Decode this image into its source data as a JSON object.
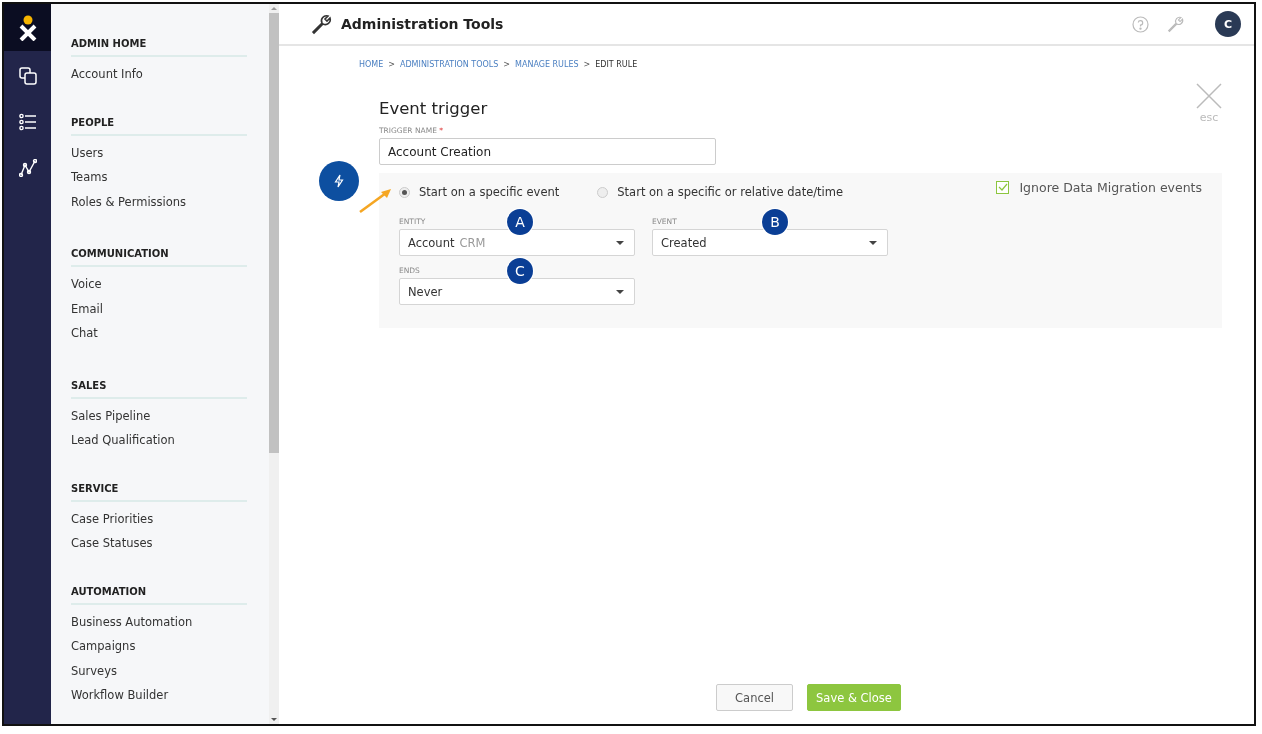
{
  "sidebar": {
    "sections": [
      {
        "title": "ADMIN HOME",
        "items": [
          "Account Info"
        ]
      },
      {
        "title": "PEOPLE",
        "items": [
          "Users",
          "Teams",
          "Roles & Permissions"
        ]
      },
      {
        "title": "COMMUNICATION",
        "items": [
          "Voice",
          "Email",
          "Chat"
        ]
      },
      {
        "title": "SALES",
        "items": [
          "Sales Pipeline",
          "Lead Qualification"
        ]
      },
      {
        "title": "SERVICE",
        "items": [
          "Case Priorities",
          "Case Statuses"
        ]
      },
      {
        "title": "AUTOMATION",
        "items": [
          "Business Automation",
          "Campaigns",
          "Surveys",
          "Workflow Builder"
        ]
      }
    ]
  },
  "header": {
    "title": "Administration Tools",
    "avatar": "C"
  },
  "breadcrumb": [
    {
      "label": "HOME",
      "current": false
    },
    {
      "label": "ADMINISTRATION TOOLS",
      "current": false
    },
    {
      "label": "MANAGE RULES",
      "current": false
    },
    {
      "label": "EDIT RULE",
      "current": true
    }
  ],
  "breadcrumb_separator": ">",
  "form": {
    "title": "Event trigger",
    "close_hint": "esc",
    "trigger_name": {
      "label": "TRIGGER NAME",
      "required_mark": "*",
      "value": "Account Creation"
    },
    "start_options": [
      {
        "label": "Start on a specific event",
        "selected": true
      },
      {
        "label": "Start on a specific or relative date/time",
        "selected": false
      }
    ],
    "ignore_migration": {
      "label": "Ignore Data Migration events",
      "checked": true
    },
    "entity": {
      "label": "ENTITY",
      "value": "Account",
      "tag": "CRM",
      "marker": "A"
    },
    "event": {
      "label": "EVENT",
      "value": "Created",
      "marker": "B"
    },
    "ends": {
      "label": "ENDS",
      "value": "Never",
      "marker": "C"
    }
  },
  "buttons": [
    {
      "label": "Cancel",
      "kind": "secondary"
    },
    {
      "label": "Save & Close",
      "kind": "primary"
    }
  ]
}
